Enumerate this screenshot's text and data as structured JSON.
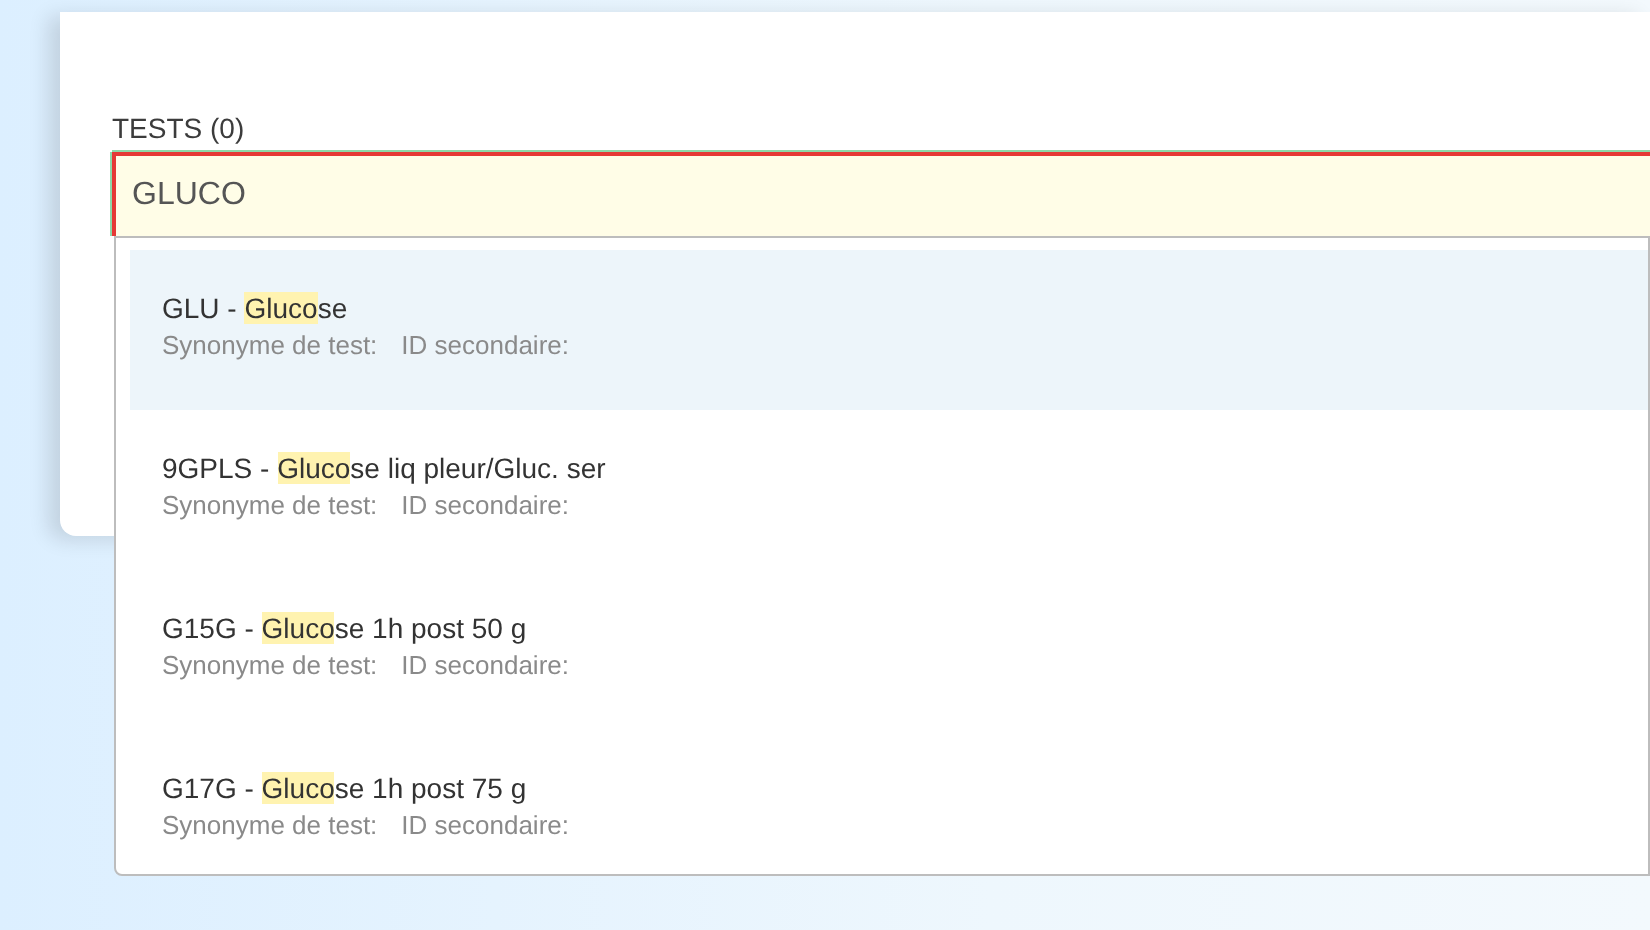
{
  "field": {
    "label": "TESTS (0)",
    "value": "GLUCO"
  },
  "suggestions": [
    {
      "code": "GLU - ",
      "match": "Gluco",
      "rest": "se",
      "synonym_label": "Synonyme de test:",
      "secondary_label": "ID secondaire:",
      "selected": true
    },
    {
      "code": "9GPLS - ",
      "match": "Gluco",
      "rest": "se liq pleur/Gluc. ser",
      "synonym_label": "Synonyme de test:",
      "secondary_label": "ID secondaire:",
      "selected": false
    },
    {
      "code": "G15G - ",
      "match": "Gluco",
      "rest": "se 1h post 50 g",
      "synonym_label": "Synonyme de test:",
      "secondary_label": "ID secondaire:",
      "selected": false
    },
    {
      "code": "G17G - ",
      "match": "Gluco",
      "rest": "se 1h post 75 g",
      "synonym_label": "Synonyme de test:",
      "secondary_label": "ID secondaire:",
      "selected": false
    }
  ]
}
